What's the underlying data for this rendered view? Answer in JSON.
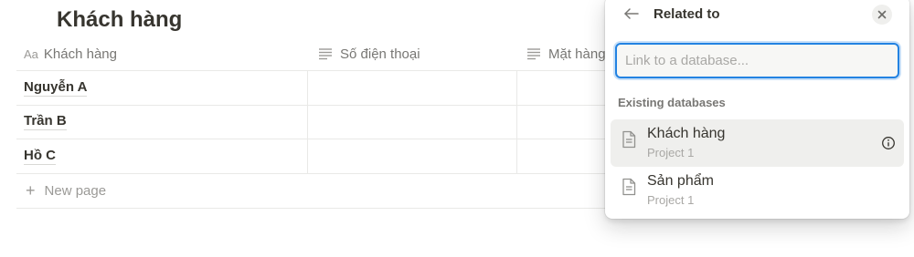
{
  "page": {
    "title": "Khách hàng"
  },
  "table": {
    "columns": [
      {
        "icon": "Aa",
        "label": "Khách hàng"
      },
      {
        "icon": "text-lines-icon",
        "label": "Số điện thoại"
      },
      {
        "icon": "text-lines-icon",
        "label": "Mặt hàng"
      }
    ],
    "rows": [
      {
        "name": "Nguyễn A"
      },
      {
        "name": "Trần B"
      },
      {
        "name": "Hồ C"
      }
    ],
    "new_page_label": "New page"
  },
  "popup": {
    "title": "Related to",
    "search_placeholder": "Link to a database...",
    "section_label": "Existing databases",
    "databases": [
      {
        "name": "Khách hàng",
        "subtitle": "Project 1"
      },
      {
        "name": "Sản phẩm",
        "subtitle": "Project 1"
      }
    ]
  },
  "colors": {
    "accent": "#2383e2",
    "text": "#37352f",
    "muted": "#787774",
    "hover": "#efefed"
  }
}
